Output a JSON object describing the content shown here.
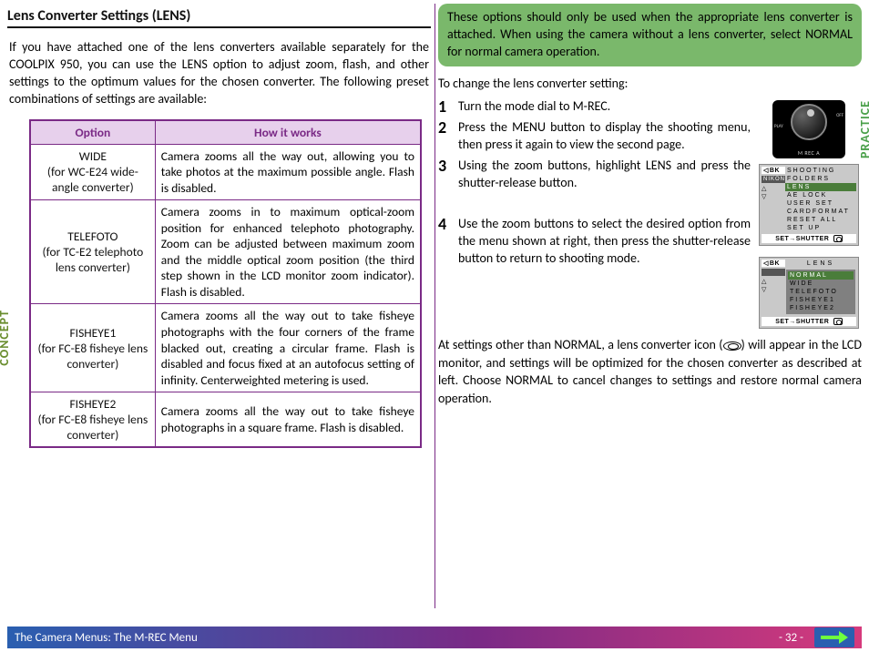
{
  "heading": "Lens Converter Settings (LENS)",
  "intro": "If you have attached one of the lens converters available separately for the COOLPIX 950, you can use the LENS option to adjust zoom, flash, and other settings to the optimum values for the chosen converter.  The following preset combinations of settings are available:",
  "table": {
    "headers": {
      "option": "Option",
      "how": "How it works"
    },
    "rows": [
      {
        "option": "WIDE\n(for WC-E24 wide-angle converter)",
        "desc": "Camera zooms all the way out, allowing you to take photos at the maximum possible angle.  Flash is disabled."
      },
      {
        "option": "TELEFOTO\n(for TC-E2 telephoto lens converter)",
        "desc": "Camera zooms in to maximum optical-zoom position for enhanced telephoto photography.  Zoom can be adjusted between maximum zoom and the middle optical zoom position (the third step shown in the LCD monitor zoom indicator).  Flash is disabled."
      },
      {
        "option": "FISHEYE1\n(for FC-E8 fisheye lens converter)",
        "desc": "Camera zooms all the way out to take fisheye photographs with the four corners of the frame blacked out, creating a circular frame.  Flash is disabled and focus fixed at an autofocus setting of infinity.  Centerweighted metering is used."
      },
      {
        "option": "FISHEYE2\n(for FC-E8 fisheye lens converter)",
        "desc": "Camera zooms all the way out to take fisheye photographs in a square frame.  Flash is disabled."
      }
    ]
  },
  "note": "These options should only be used when the appropriate lens converter is attached.  When using the camera without a lens converter, select NORMAL for normal camera operation.",
  "steps_lead": "To change the lens converter setting:",
  "steps": [
    "Turn the mode dial to M-REC.",
    "Press the MENU button to display the shooting menu, then press it again to view the second page.",
    "Using the zoom buttons, highlight LENS and press the shutter-release button.",
    "Use the zoom buttons to select the desired option from the menu shown at right, then press the shutter-release button to return to shooting mode."
  ],
  "dial": {
    "off": "OFF",
    "play": "PLAY",
    "bottom": "M REC A"
  },
  "lcd1": {
    "bk": "BK",
    "items": [
      "SHOOTING",
      "FOLDERS",
      "LENS",
      "AE LOCK",
      "USER SET",
      "CARDFORMAT",
      "RESET ALL",
      "SET UP"
    ],
    "selected_index": 2,
    "nikon": "NIKON",
    "set_label": "SET→SHUTTER"
  },
  "lcd2": {
    "bk": "BK",
    "title": "LENS",
    "items": [
      "NORMAL",
      "WIDE",
      "TELEFOTO",
      "FISHEYE1",
      "FISHEYE2"
    ],
    "selected_index": 0,
    "set_label": "SET→SHUTTER"
  },
  "closing_pre": "At settings other than NORMAL, a lens converter icon (",
  "closing_post": ") will appear in the LCD monitor, and settings will be optimized for the chosen converter as described at left.  Choose NORMAL to cancel changes to settings and restore normal camera operation.",
  "side": {
    "concept": "CONCEPT",
    "practice": "PRACTICE"
  },
  "footer": {
    "title": "The Camera Menus: The M-REC Menu",
    "page": "- 32 -"
  }
}
